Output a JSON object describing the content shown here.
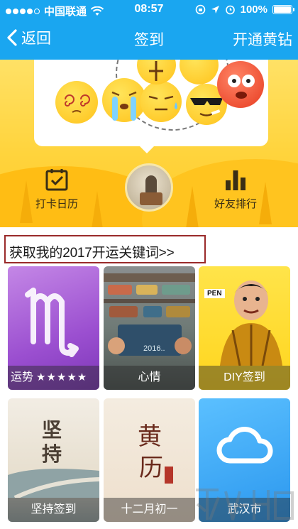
{
  "status_bar": {
    "carrier": "中国联通",
    "time": "08:57",
    "battery": "100%",
    "signal_bars": 4,
    "battery_level": 1.0
  },
  "nav": {
    "back_label": "返回",
    "title": "签到",
    "action_label": "开通黄钻"
  },
  "banner": {
    "calendar_label": "打卡日历",
    "rank_label": "好友排行"
  },
  "keyword_link": "获取我的2017开运关键词>>",
  "tiles": {
    "fortune": {
      "label": "运势",
      "stars": "★★★★★",
      "rating": 5
    },
    "mood": {
      "label": "心情",
      "photo_text": "2016.."
    },
    "diy": {
      "label": "DIY签到",
      "badge": "PEN"
    },
    "persist": {
      "label": "坚持签到",
      "art_text": "坚持"
    },
    "lunar": {
      "label": "十二月初一",
      "art_text_1": "黄",
      "art_text_2": "历"
    },
    "weather": {
      "label": "武汉市"
    }
  },
  "colors": {
    "nav_blue": "#1aa6f0",
    "banner_yellow": "#ffd43d",
    "keyword_border": "#9a2a2a"
  },
  "icons": {
    "back": "chevron-left-icon",
    "calendar": "calendar-check-icon",
    "rank": "bar-chart-icon",
    "weather": "cloud-icon",
    "fortune": "scorpio-icon"
  }
}
